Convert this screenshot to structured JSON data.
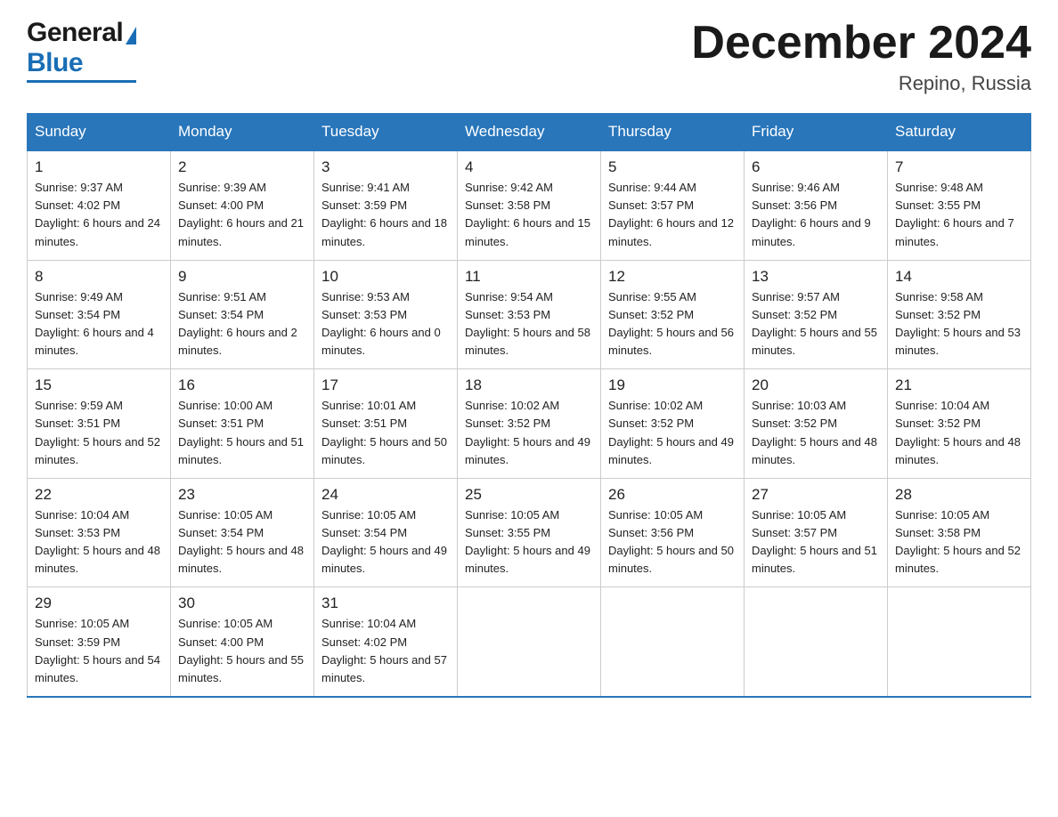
{
  "header": {
    "logo_general": "General",
    "logo_blue": "Blue",
    "month_year": "December 2024",
    "location": "Repino, Russia"
  },
  "days_of_week": [
    "Sunday",
    "Monday",
    "Tuesday",
    "Wednesday",
    "Thursday",
    "Friday",
    "Saturday"
  ],
  "weeks": [
    [
      {
        "num": "1",
        "sunrise": "9:37 AM",
        "sunset": "4:02 PM",
        "daylight": "6 hours and 24 minutes."
      },
      {
        "num": "2",
        "sunrise": "9:39 AM",
        "sunset": "4:00 PM",
        "daylight": "6 hours and 21 minutes."
      },
      {
        "num": "3",
        "sunrise": "9:41 AM",
        "sunset": "3:59 PM",
        "daylight": "6 hours and 18 minutes."
      },
      {
        "num": "4",
        "sunrise": "9:42 AM",
        "sunset": "3:58 PM",
        "daylight": "6 hours and 15 minutes."
      },
      {
        "num": "5",
        "sunrise": "9:44 AM",
        "sunset": "3:57 PM",
        "daylight": "6 hours and 12 minutes."
      },
      {
        "num": "6",
        "sunrise": "9:46 AM",
        "sunset": "3:56 PM",
        "daylight": "6 hours and 9 minutes."
      },
      {
        "num": "7",
        "sunrise": "9:48 AM",
        "sunset": "3:55 PM",
        "daylight": "6 hours and 7 minutes."
      }
    ],
    [
      {
        "num": "8",
        "sunrise": "9:49 AM",
        "sunset": "3:54 PM",
        "daylight": "6 hours and 4 minutes."
      },
      {
        "num": "9",
        "sunrise": "9:51 AM",
        "sunset": "3:54 PM",
        "daylight": "6 hours and 2 minutes."
      },
      {
        "num": "10",
        "sunrise": "9:53 AM",
        "sunset": "3:53 PM",
        "daylight": "6 hours and 0 minutes."
      },
      {
        "num": "11",
        "sunrise": "9:54 AM",
        "sunset": "3:53 PM",
        "daylight": "5 hours and 58 minutes."
      },
      {
        "num": "12",
        "sunrise": "9:55 AM",
        "sunset": "3:52 PM",
        "daylight": "5 hours and 56 minutes."
      },
      {
        "num": "13",
        "sunrise": "9:57 AM",
        "sunset": "3:52 PM",
        "daylight": "5 hours and 55 minutes."
      },
      {
        "num": "14",
        "sunrise": "9:58 AM",
        "sunset": "3:52 PM",
        "daylight": "5 hours and 53 minutes."
      }
    ],
    [
      {
        "num": "15",
        "sunrise": "9:59 AM",
        "sunset": "3:51 PM",
        "daylight": "5 hours and 52 minutes."
      },
      {
        "num": "16",
        "sunrise": "10:00 AM",
        "sunset": "3:51 PM",
        "daylight": "5 hours and 51 minutes."
      },
      {
        "num": "17",
        "sunrise": "10:01 AM",
        "sunset": "3:51 PM",
        "daylight": "5 hours and 50 minutes."
      },
      {
        "num": "18",
        "sunrise": "10:02 AM",
        "sunset": "3:52 PM",
        "daylight": "5 hours and 49 minutes."
      },
      {
        "num": "19",
        "sunrise": "10:02 AM",
        "sunset": "3:52 PM",
        "daylight": "5 hours and 49 minutes."
      },
      {
        "num": "20",
        "sunrise": "10:03 AM",
        "sunset": "3:52 PM",
        "daylight": "5 hours and 48 minutes."
      },
      {
        "num": "21",
        "sunrise": "10:04 AM",
        "sunset": "3:52 PM",
        "daylight": "5 hours and 48 minutes."
      }
    ],
    [
      {
        "num": "22",
        "sunrise": "10:04 AM",
        "sunset": "3:53 PM",
        "daylight": "5 hours and 48 minutes."
      },
      {
        "num": "23",
        "sunrise": "10:05 AM",
        "sunset": "3:54 PM",
        "daylight": "5 hours and 48 minutes."
      },
      {
        "num": "24",
        "sunrise": "10:05 AM",
        "sunset": "3:54 PM",
        "daylight": "5 hours and 49 minutes."
      },
      {
        "num": "25",
        "sunrise": "10:05 AM",
        "sunset": "3:55 PM",
        "daylight": "5 hours and 49 minutes."
      },
      {
        "num": "26",
        "sunrise": "10:05 AM",
        "sunset": "3:56 PM",
        "daylight": "5 hours and 50 minutes."
      },
      {
        "num": "27",
        "sunrise": "10:05 AM",
        "sunset": "3:57 PM",
        "daylight": "5 hours and 51 minutes."
      },
      {
        "num": "28",
        "sunrise": "10:05 AM",
        "sunset": "3:58 PM",
        "daylight": "5 hours and 52 minutes."
      }
    ],
    [
      {
        "num": "29",
        "sunrise": "10:05 AM",
        "sunset": "3:59 PM",
        "daylight": "5 hours and 54 minutes."
      },
      {
        "num": "30",
        "sunrise": "10:05 AM",
        "sunset": "4:00 PM",
        "daylight": "5 hours and 55 minutes."
      },
      {
        "num": "31",
        "sunrise": "10:04 AM",
        "sunset": "4:02 PM",
        "daylight": "5 hours and 57 minutes."
      },
      null,
      null,
      null,
      null
    ]
  ],
  "labels": {
    "sunrise": "Sunrise: ",
    "sunset": "Sunset: ",
    "daylight": "Daylight: "
  }
}
